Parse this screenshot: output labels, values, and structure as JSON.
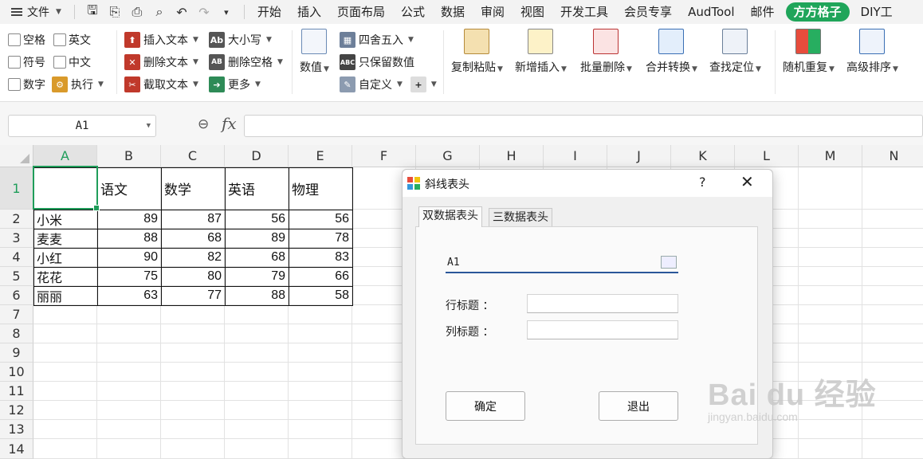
{
  "menubar": {
    "file_label": "文件",
    "tabs": [
      {
        "label": "开始"
      },
      {
        "label": "插入"
      },
      {
        "label": "页面布局"
      },
      {
        "label": "公式"
      },
      {
        "label": "数据"
      },
      {
        "label": "审阅"
      },
      {
        "label": "视图"
      },
      {
        "label": "开发工具"
      },
      {
        "label": "会员专享"
      },
      {
        "label": "AudTool"
      },
      {
        "label": "邮件"
      },
      {
        "label": "方方格子"
      },
      {
        "label": "DIY工"
      }
    ],
    "active_tab": "方方格子",
    "active_color": "#1fa55a"
  },
  "ribbon": {
    "checkboxes": [
      "空格",
      "英文",
      "符号",
      "中文",
      "数字"
    ],
    "exec_label": "执行",
    "text_tools": [
      "插入文本",
      "删除文本",
      "截取文本"
    ],
    "case_tools": [
      "大小写",
      "删除空格",
      "更多"
    ],
    "numeric_label": "数值",
    "round_tools": [
      "四舍五入",
      "只保留数值",
      "自定义"
    ],
    "big_buttons": [
      "复制粘贴",
      "新增插入",
      "批量删除",
      "合并转换",
      "查找定位",
      "随机重复",
      "高级排序"
    ]
  },
  "formula_bar": {
    "cell_ref": "A1",
    "fx": "fx",
    "formula": ""
  },
  "sheet": {
    "columns": [
      "A",
      "B",
      "C",
      "D",
      "E",
      "F",
      "G",
      "H",
      "I",
      "J",
      "K",
      "L",
      "M",
      "N"
    ],
    "rows": [
      "1",
      "2",
      "3",
      "4",
      "5",
      "6",
      "7",
      "8",
      "9",
      "10",
      "11",
      "12",
      "13",
      "14"
    ],
    "header_row": [
      "",
      "语文",
      "数学",
      "英语",
      "物理"
    ],
    "data": [
      {
        "name": "小米",
        "scores": [
          "89",
          "87",
          "56",
          "56"
        ]
      },
      {
        "name": "麦麦",
        "scores": [
          "88",
          "68",
          "89",
          "78"
        ]
      },
      {
        "name": "小红",
        "scores": [
          "90",
          "82",
          "68",
          "83"
        ]
      },
      {
        "name": "花花",
        "scores": [
          "75",
          "80",
          "79",
          "66"
        ]
      },
      {
        "name": "丽丽",
        "scores": [
          "63",
          "77",
          "88",
          "58"
        ]
      }
    ],
    "selected_cell": "A1",
    "selection_color": "#1f9d5a"
  },
  "dialog": {
    "title": "斜线表头",
    "help": "?",
    "close": "✕",
    "tabs": [
      "双数据表头",
      "三数据表头"
    ],
    "active_tab": "双数据表头",
    "range_value": "A1",
    "row_title_label": "行标题 ：",
    "row_title_value": "",
    "col_title_label": "列标题 ：",
    "col_title_value": "",
    "ok_label": "确定",
    "exit_label": "退出"
  },
  "watermark": {
    "main": "Bai du 经验",
    "sub": "jingyan.baidu.com"
  }
}
